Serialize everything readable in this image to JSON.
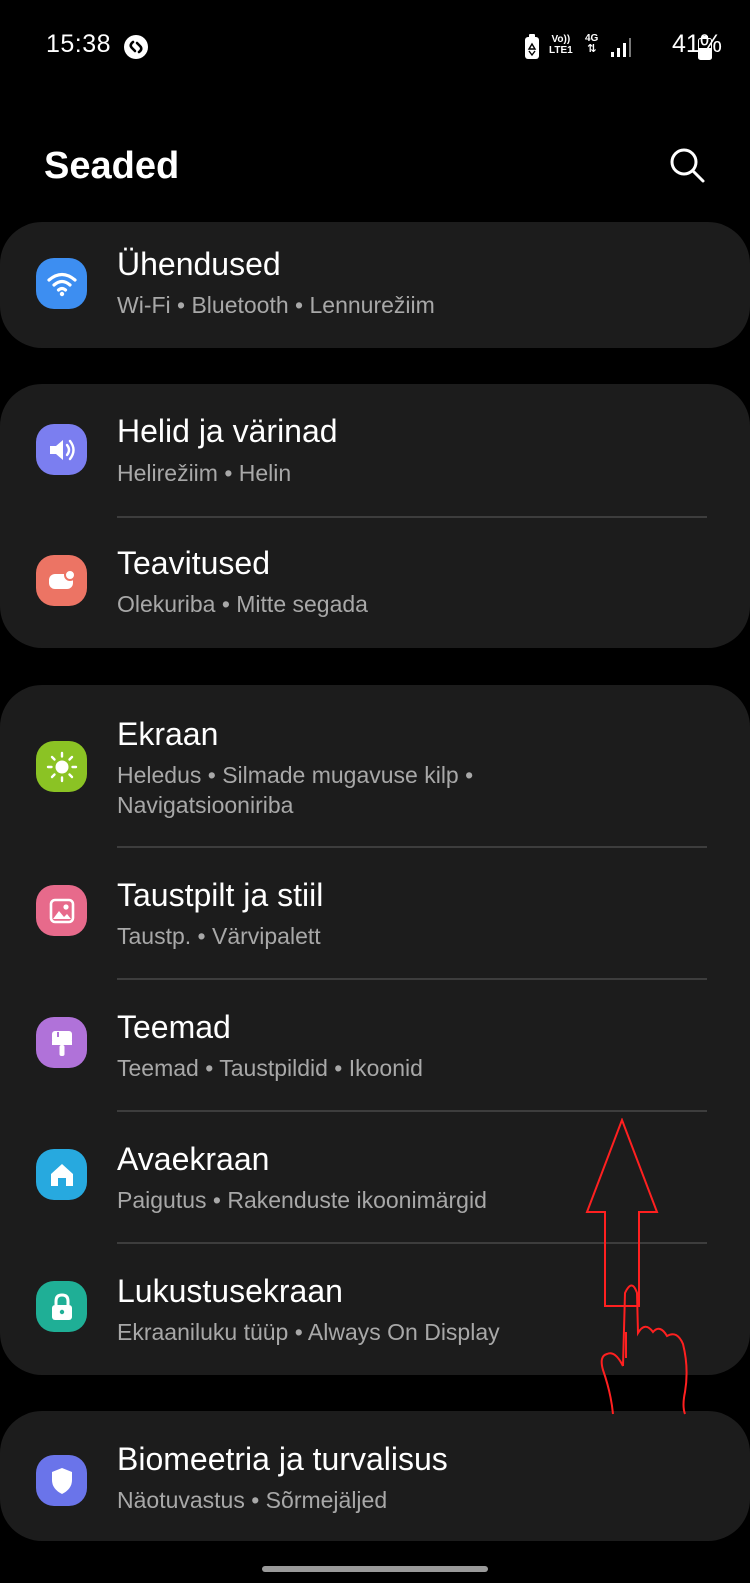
{
  "status_bar": {
    "time": "15:38",
    "app_icon": "shazam-icon",
    "volte_line1": "Vo))",
    "volte_line2": "LTE1",
    "network": "4G",
    "battery_percent": "41%"
  },
  "header": {
    "title": "Seaded",
    "search_icon": "search-icon"
  },
  "groups": [
    {
      "items": [
        {
          "title": "Ühendused",
          "subtitle": "Wi-Fi  •  Bluetooth  •  Lennurežiim",
          "icon": "wifi-icon",
          "color": "#3d8ef1"
        }
      ]
    },
    {
      "items": [
        {
          "title": "Helid ja värinad",
          "subtitle": "Helirežiim  •  Helin",
          "icon": "volume-icon",
          "color": "#7b7ef0"
        },
        {
          "title": "Teavitused",
          "subtitle": "Olekuriba  •  Mitte segada",
          "icon": "notification-icon",
          "color": "#ec7464"
        }
      ]
    },
    {
      "items": [
        {
          "title": "Ekraan",
          "subtitle": "Heledus  •  Silmade mugavuse kilp  •",
          "subtitle2": "Navigatsiooniriba",
          "icon": "brightness-icon",
          "color": "#8bc324"
        },
        {
          "title": "Taustpilt ja stiil",
          "subtitle": "Taustp.  •  Värvipalett",
          "icon": "wallpaper-icon",
          "color": "#e76a8b"
        },
        {
          "title": "Teemad",
          "subtitle": "Teemad  •  Taustpildid  •  Ikoonid",
          "icon": "theme-brush-icon",
          "color": "#b072d9"
        },
        {
          "title": "Avaekraan",
          "subtitle": "Paigutus  •  Rakenduste ikoonimärgid",
          "icon": "home-icon",
          "color": "#27a9df"
        },
        {
          "title": "Lukustusekraan",
          "subtitle": "Ekraaniluku tüüp  •  Always On Display",
          "icon": "lock-icon",
          "color": "#1faf96"
        }
      ]
    },
    {
      "items": [
        {
          "title": "Biomeetria ja turvalisus",
          "subtitle": "Näotuvastus  •  Sõrmejäljed",
          "icon": "shield-icon",
          "color": "#6a74ea"
        }
      ]
    }
  ],
  "overlay": {
    "gesture": "swipe-up-hand-icon",
    "color": "#ff2020"
  }
}
